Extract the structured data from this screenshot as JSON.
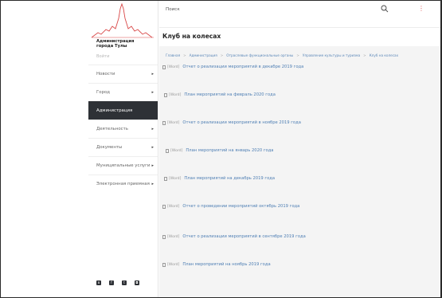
{
  "logo": {
    "title": "Администрация\nгорода Тулы"
  },
  "sidebar": {
    "login_label": "Войти",
    "items": [
      {
        "label": "Новости",
        "has_arrow": true,
        "active": false
      },
      {
        "label": "Город",
        "has_arrow": true,
        "active": false
      },
      {
        "label": "Администрация",
        "has_arrow": false,
        "active": true
      },
      {
        "label": "Деятельность",
        "has_arrow": true,
        "active": false
      },
      {
        "label": "Документы",
        "has_arrow": true,
        "active": false
      },
      {
        "label": "Муниципальные услуги",
        "has_arrow": true,
        "active": false
      },
      {
        "label": "Электронная приемная",
        "has_arrow": true,
        "active": false
      }
    ],
    "arrow_glyph": "▸",
    "socials": [
      "vk-icon",
      "facebook-icon",
      "twitter-icon",
      "instagram-icon"
    ]
  },
  "search": {
    "placeholder": "Поиск"
  },
  "page": {
    "title": "Клуб на колесах"
  },
  "breadcrumb": {
    "items": [
      "Главная",
      "Администрация",
      "Отраслевые функциональные органы",
      "Управление культуры и туризма",
      "Клуб на колесах"
    ],
    "separator": ">"
  },
  "documents": [
    {
      "meta": "[Word]",
      "title": "Отчет о реализации мероприятий в декабре 2019 года"
    },
    {
      "meta": "[Word]",
      "title": "План мероприятий на февраль 2020 года"
    },
    {
      "meta": "[Word]",
      "title": "Отчет о реализации мероприятий в ноябре 2019 года"
    },
    {
      "meta": "[Word]",
      "title": "План мероприятий на январь 2020 года"
    },
    {
      "meta": "[Word]",
      "title": "План мероприятий на декабрь 2019 года"
    },
    {
      "meta": "[Word]",
      "title": "Отчет о проведении мероприятий октябрь 2019 года"
    },
    {
      "meta": "[Word]",
      "title": "Отчет о реализации мероприятий в сентябре 2019 года"
    },
    {
      "meta": "[Word]",
      "title": "План мероприятий на ноябрь 2019 года"
    }
  ],
  "colors": {
    "accent": "#d94848",
    "link": "#4f7fb4",
    "active_nav": "#2e3136"
  }
}
